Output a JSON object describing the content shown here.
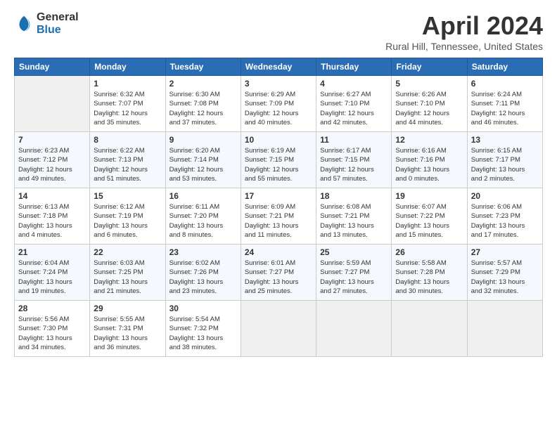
{
  "logo": {
    "general": "General",
    "blue": "Blue"
  },
  "header": {
    "month_year": "April 2024",
    "location": "Rural Hill, Tennessee, United States"
  },
  "weekdays": [
    "Sunday",
    "Monday",
    "Tuesday",
    "Wednesday",
    "Thursday",
    "Friday",
    "Saturday"
  ],
  "weeks": [
    [
      {
        "day": "",
        "info": ""
      },
      {
        "day": "1",
        "info": "Sunrise: 6:32 AM\nSunset: 7:07 PM\nDaylight: 12 hours\nand 35 minutes."
      },
      {
        "day": "2",
        "info": "Sunrise: 6:30 AM\nSunset: 7:08 PM\nDaylight: 12 hours\nand 37 minutes."
      },
      {
        "day": "3",
        "info": "Sunrise: 6:29 AM\nSunset: 7:09 PM\nDaylight: 12 hours\nand 40 minutes."
      },
      {
        "day": "4",
        "info": "Sunrise: 6:27 AM\nSunset: 7:10 PM\nDaylight: 12 hours\nand 42 minutes."
      },
      {
        "day": "5",
        "info": "Sunrise: 6:26 AM\nSunset: 7:10 PM\nDaylight: 12 hours\nand 44 minutes."
      },
      {
        "day": "6",
        "info": "Sunrise: 6:24 AM\nSunset: 7:11 PM\nDaylight: 12 hours\nand 46 minutes."
      }
    ],
    [
      {
        "day": "7",
        "info": "Sunrise: 6:23 AM\nSunset: 7:12 PM\nDaylight: 12 hours\nand 49 minutes."
      },
      {
        "day": "8",
        "info": "Sunrise: 6:22 AM\nSunset: 7:13 PM\nDaylight: 12 hours\nand 51 minutes."
      },
      {
        "day": "9",
        "info": "Sunrise: 6:20 AM\nSunset: 7:14 PM\nDaylight: 12 hours\nand 53 minutes."
      },
      {
        "day": "10",
        "info": "Sunrise: 6:19 AM\nSunset: 7:15 PM\nDaylight: 12 hours\nand 55 minutes."
      },
      {
        "day": "11",
        "info": "Sunrise: 6:17 AM\nSunset: 7:15 PM\nDaylight: 12 hours\nand 57 minutes."
      },
      {
        "day": "12",
        "info": "Sunrise: 6:16 AM\nSunset: 7:16 PM\nDaylight: 13 hours\nand 0 minutes."
      },
      {
        "day": "13",
        "info": "Sunrise: 6:15 AM\nSunset: 7:17 PM\nDaylight: 13 hours\nand 2 minutes."
      }
    ],
    [
      {
        "day": "14",
        "info": "Sunrise: 6:13 AM\nSunset: 7:18 PM\nDaylight: 13 hours\nand 4 minutes."
      },
      {
        "day": "15",
        "info": "Sunrise: 6:12 AM\nSunset: 7:19 PM\nDaylight: 13 hours\nand 6 minutes."
      },
      {
        "day": "16",
        "info": "Sunrise: 6:11 AM\nSunset: 7:20 PM\nDaylight: 13 hours\nand 8 minutes."
      },
      {
        "day": "17",
        "info": "Sunrise: 6:09 AM\nSunset: 7:21 PM\nDaylight: 13 hours\nand 11 minutes."
      },
      {
        "day": "18",
        "info": "Sunrise: 6:08 AM\nSunset: 7:21 PM\nDaylight: 13 hours\nand 13 minutes."
      },
      {
        "day": "19",
        "info": "Sunrise: 6:07 AM\nSunset: 7:22 PM\nDaylight: 13 hours\nand 15 minutes."
      },
      {
        "day": "20",
        "info": "Sunrise: 6:06 AM\nSunset: 7:23 PM\nDaylight: 13 hours\nand 17 minutes."
      }
    ],
    [
      {
        "day": "21",
        "info": "Sunrise: 6:04 AM\nSunset: 7:24 PM\nDaylight: 13 hours\nand 19 minutes."
      },
      {
        "day": "22",
        "info": "Sunrise: 6:03 AM\nSunset: 7:25 PM\nDaylight: 13 hours\nand 21 minutes."
      },
      {
        "day": "23",
        "info": "Sunrise: 6:02 AM\nSunset: 7:26 PM\nDaylight: 13 hours\nand 23 minutes."
      },
      {
        "day": "24",
        "info": "Sunrise: 6:01 AM\nSunset: 7:27 PM\nDaylight: 13 hours\nand 25 minutes."
      },
      {
        "day": "25",
        "info": "Sunrise: 5:59 AM\nSunset: 7:27 PM\nDaylight: 13 hours\nand 27 minutes."
      },
      {
        "day": "26",
        "info": "Sunrise: 5:58 AM\nSunset: 7:28 PM\nDaylight: 13 hours\nand 30 minutes."
      },
      {
        "day": "27",
        "info": "Sunrise: 5:57 AM\nSunset: 7:29 PM\nDaylight: 13 hours\nand 32 minutes."
      }
    ],
    [
      {
        "day": "28",
        "info": "Sunrise: 5:56 AM\nSunset: 7:30 PM\nDaylight: 13 hours\nand 34 minutes."
      },
      {
        "day": "29",
        "info": "Sunrise: 5:55 AM\nSunset: 7:31 PM\nDaylight: 13 hours\nand 36 minutes."
      },
      {
        "day": "30",
        "info": "Sunrise: 5:54 AM\nSunset: 7:32 PM\nDaylight: 13 hours\nand 38 minutes."
      },
      {
        "day": "",
        "info": ""
      },
      {
        "day": "",
        "info": ""
      },
      {
        "day": "",
        "info": ""
      },
      {
        "day": "",
        "info": ""
      }
    ]
  ]
}
